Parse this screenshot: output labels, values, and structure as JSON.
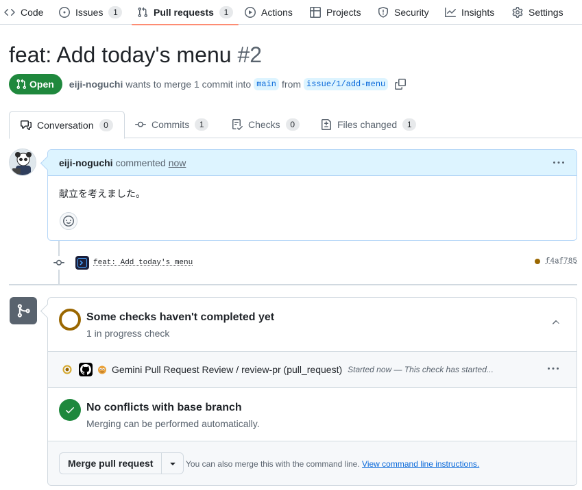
{
  "nav": {
    "code": "Code",
    "issues": "Issues",
    "issues_count": "1",
    "pull_requests": "Pull requests",
    "pull_requests_count": "1",
    "actions": "Actions",
    "projects": "Projects",
    "security": "Security",
    "insights": "Insights",
    "settings": "Settings"
  },
  "pr": {
    "title": "feat: Add today's menu",
    "number": "#2",
    "state": "Open",
    "author": "eiji-noguchi",
    "merge_text": "wants to merge 1 commit into",
    "base_branch": "main",
    "from_text": "from",
    "head_branch": "issue/1/add-menu"
  },
  "tabs": {
    "conversation": "Conversation",
    "conversation_count": "0",
    "commits": "Commits",
    "commits_count": "1",
    "checks": "Checks",
    "checks_count": "0",
    "files_changed": "Files changed",
    "files_changed_count": "1"
  },
  "comment": {
    "author": "eiji-noguchi",
    "action": "commented",
    "timestamp": "now",
    "body": "献立を考えました。"
  },
  "commit": {
    "message": "feat: Add today's menu",
    "sha": "f4af785"
  },
  "merge_box": {
    "checks_title": "Some checks haven't completed yet",
    "checks_subtitle": "1 in progress check",
    "run_name": "Gemini Pull Request Review / review-pr (pull_request)",
    "run_detail": "Started now — This check has started...",
    "conflict_title": "No conflicts with base branch",
    "conflict_subtitle": "Merging can be performed automatically.",
    "merge_button": "Merge pull request",
    "hint_text": "You can also merge this with the command line.",
    "hint_link": "View command line instructions."
  },
  "colors": {
    "open_green": "#1f883d",
    "pending_yellow": "#9a6700",
    "link_blue": "#0969da",
    "active_tab_underline": "#fd8c73"
  }
}
